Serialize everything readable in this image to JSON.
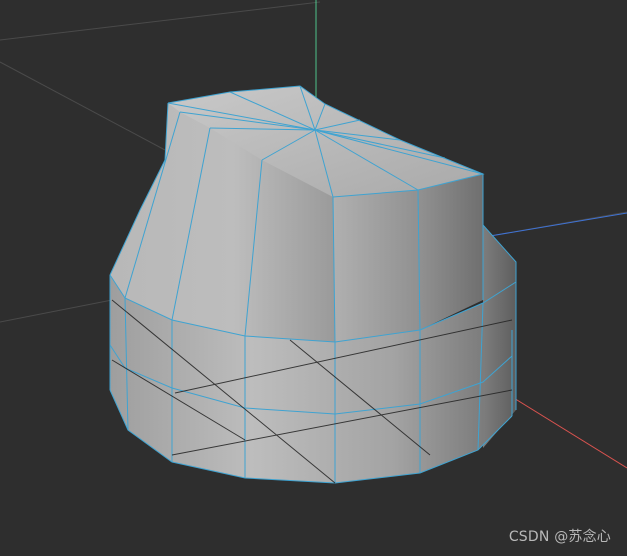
{
  "viewport": {
    "background_color": "#2e2e2e",
    "grid_color": "#4a4a4a",
    "axis_x_color": "#d9534f",
    "axis_y_color": "#4fc38a",
    "axis_z_color": "#3f73d6",
    "wireframe_color": "#3fa3d1",
    "model_shading": "grey-gradient"
  },
  "watermark": {
    "text": "CSDN @苏念心"
  }
}
